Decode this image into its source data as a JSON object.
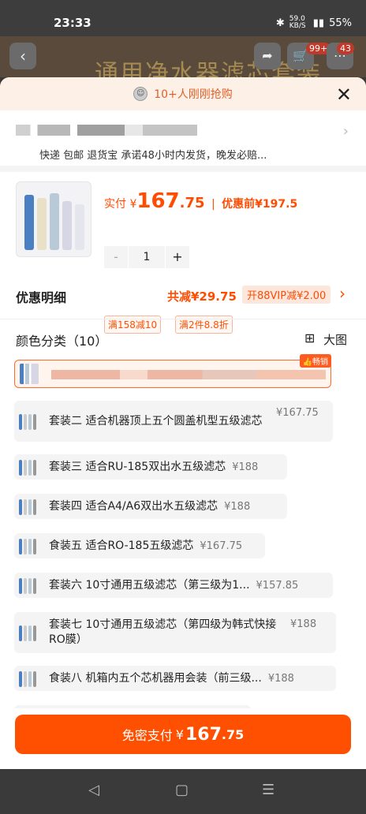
{
  "status": {
    "time": "23:33",
    "net": "59.0 KB/S",
    "battery": "55%"
  },
  "bg": {
    "title": "通用净水器滤芯套装",
    "back_icon": "chevron-left-icon",
    "badge_cart": "99+",
    "badge_msg": "43"
  },
  "banner": {
    "text": "10+人刚刚抢购",
    "close_label": "✕"
  },
  "address": {
    "info": "快递 包邮 退货宝 承诺48小时内发货，晚发必赔..."
  },
  "product": {
    "pay_prefix": "实付",
    "currency": "¥",
    "price_int": "167",
    "price_dec": ".75",
    "sep": "|",
    "orig_label": "优惠前",
    "orig_price": "¥197.5",
    "tags": [
      "满158减10",
      "满2件8.8折"
    ],
    "qty_minus": "-",
    "qty_value": "1",
    "qty_plus": "+"
  },
  "discount": {
    "label": "优惠明细",
    "total": "共减¥29.75",
    "vip": "开88VIP减¥2.00",
    "chevron": "›"
  },
  "color": {
    "label": "颜色分类（10）",
    "view_label": "大图",
    "hot_badge": "畅销"
  },
  "options": [
    {
      "name": "套装二 适合机器顶上五个圆盖机型五级滤芯",
      "price": "¥167.75"
    },
    {
      "name": "套装三 适合RU-185双出水五级滤芯",
      "price": "¥188"
    },
    {
      "name": "套装四  适合A4/A6双出水五级滤芯",
      "price": "¥188"
    },
    {
      "name": "食装五 适合RO-185五级滤芯",
      "price": "¥167.75"
    },
    {
      "name": "套装六 10寸通用五级滤芯（第三级为1...",
      "price": "¥157.85"
    },
    {
      "name": "套装七 10寸通用五级滤芯（第四级为韩式快接RO膜）",
      "price": "¥188"
    },
    {
      "name": "食装八 机箱内五个芯机器用会装（前三级...",
      "price": "¥188"
    }
  ],
  "pay": {
    "label": "免密支付",
    "currency": "¥",
    "int": "167",
    "dec": ".75"
  },
  "nav": {
    "back": "◁",
    "home": "▢",
    "menu": "☰"
  }
}
